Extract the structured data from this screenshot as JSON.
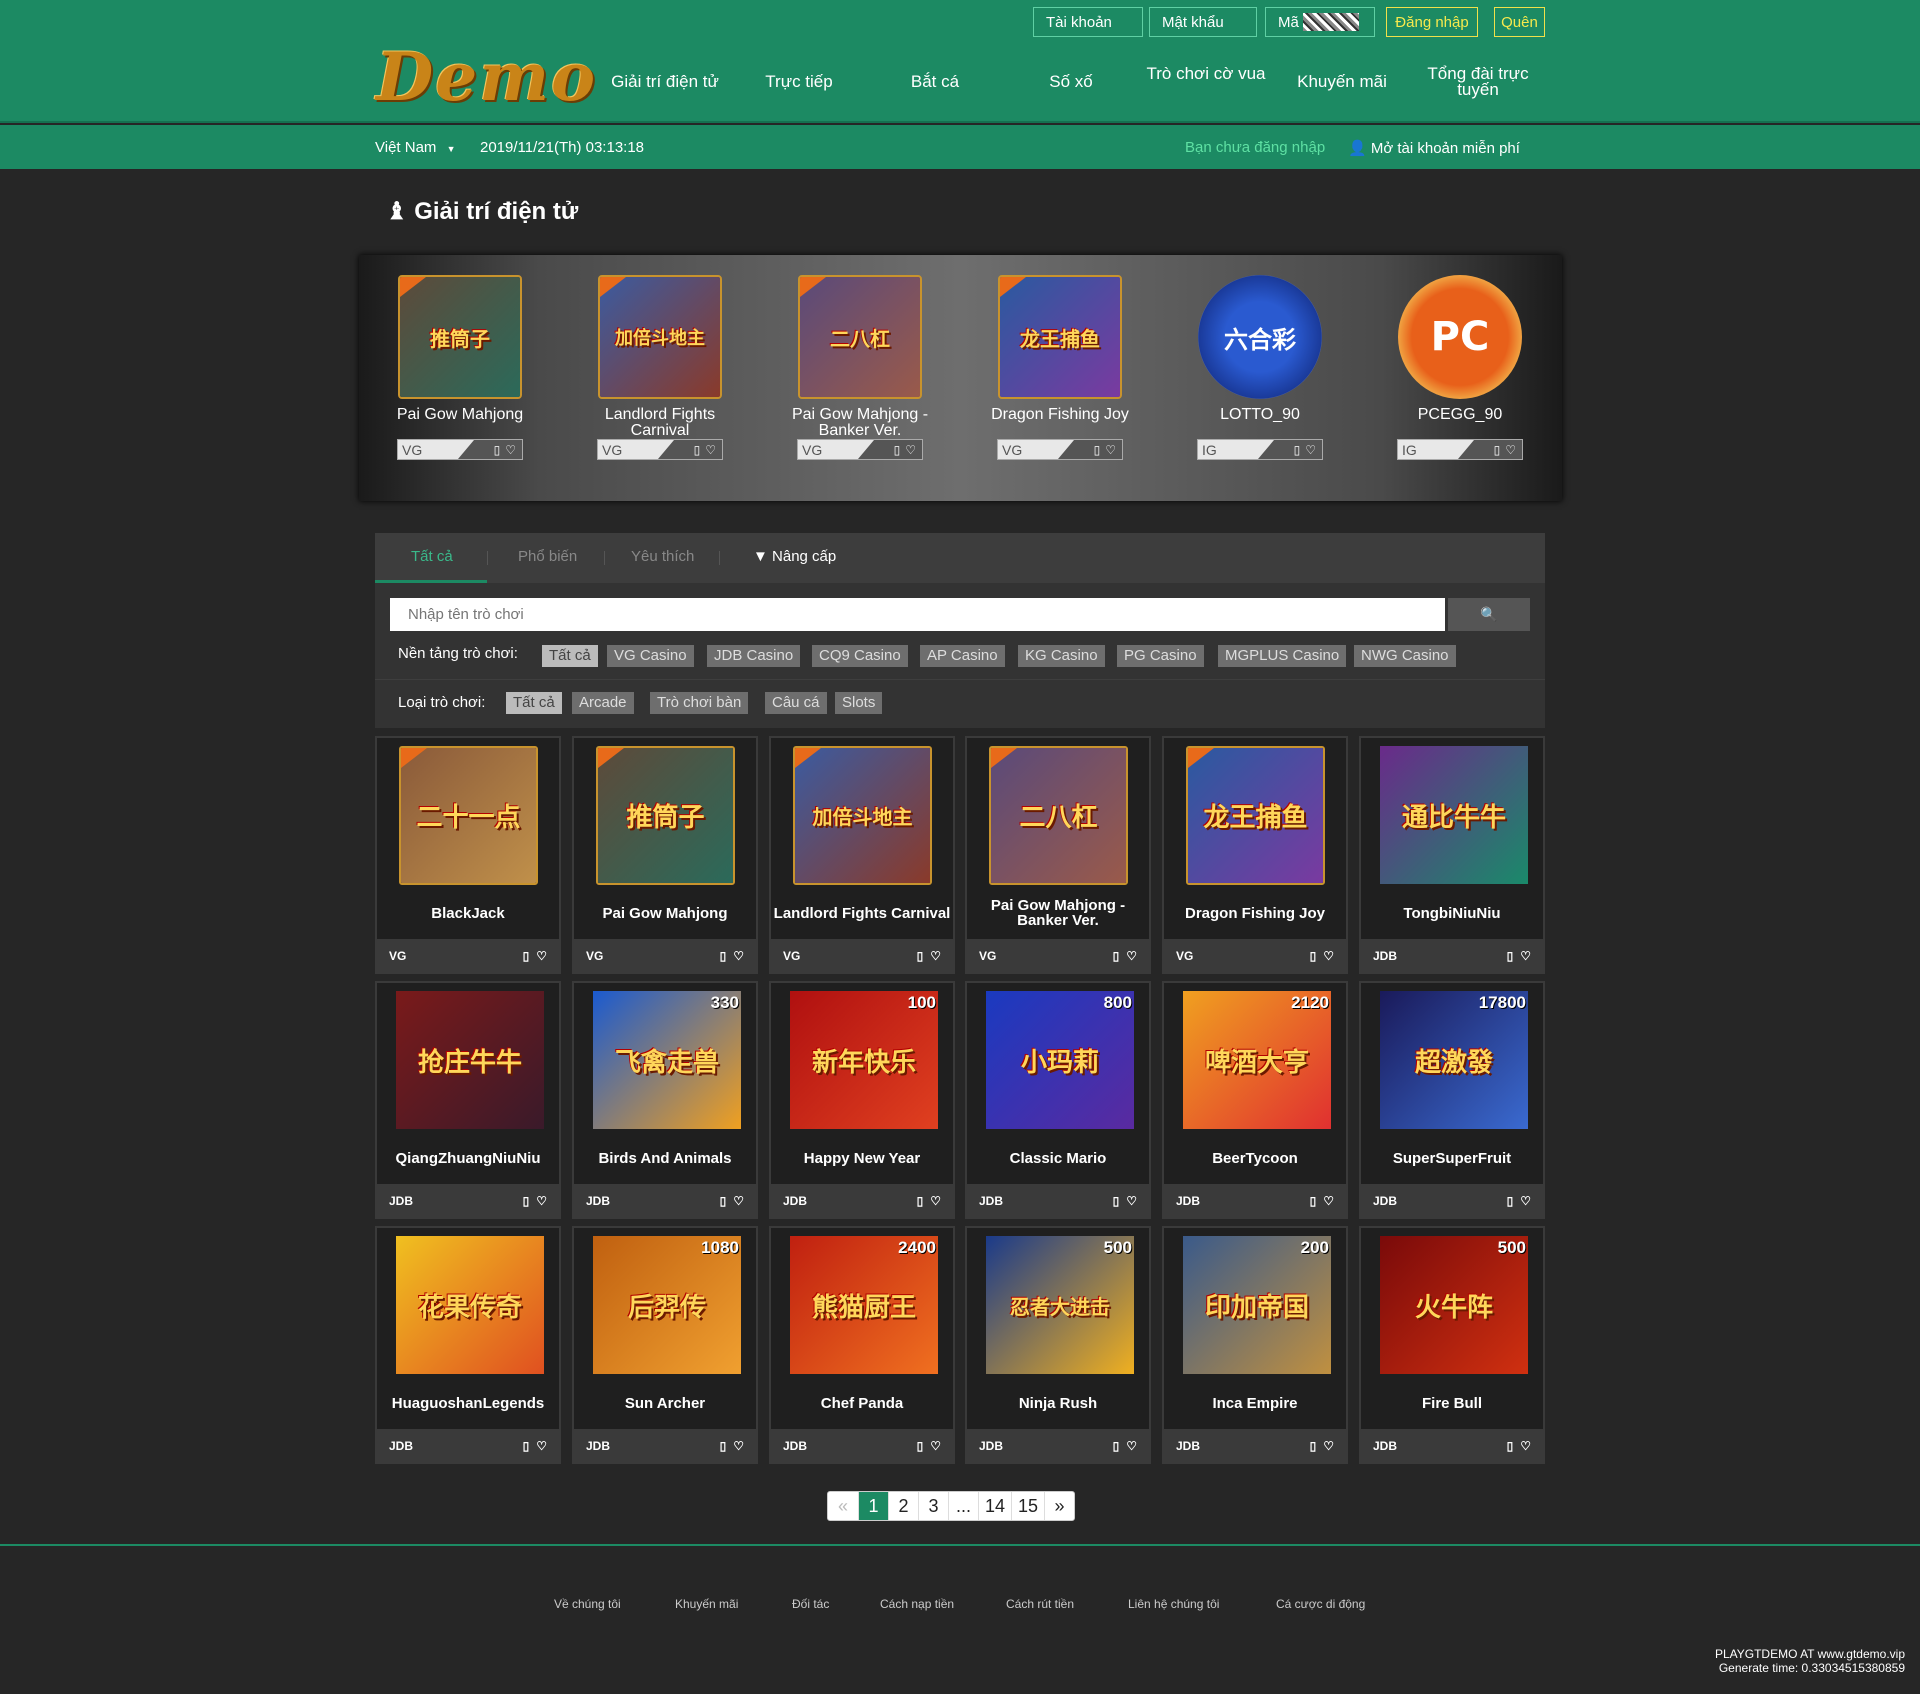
{
  "header": {
    "logo": "Demo",
    "account_placeholder": "Tài khoản",
    "password_placeholder": "Mật khẩu",
    "code_placeholder": "Mã",
    "login_label": "Đăng nhập",
    "forgot_label": "Quên",
    "nav": [
      "Giải trí điện tử",
      "Trực tiếp",
      "Bắt cá",
      "Số xố",
      "Trò chơi cờ vua",
      "Khuyến mãi",
      "Tổng đài trực tuyến"
    ]
  },
  "subbar": {
    "country": "Việt Nam",
    "datetime": "2019/11/21(Th) 03:13:18",
    "not_logged_in": "Bạn chưa đăng nhập",
    "open_account": "Mở tài khoản miễn phí"
  },
  "page_title": "Giải trí điện tử",
  "featured": [
    {
      "name": "Pai Gow Mahjong",
      "platform": "VG",
      "art": "推筒子",
      "colors": [
        "#5d4a3a",
        "#2b6a5a"
      ]
    },
    {
      "name": "Landlord Fights Carnival",
      "platform": "VG",
      "art": "加倍斗地主",
      "colors": [
        "#3b5ba0",
        "#8a3a2a"
      ]
    },
    {
      "name": "Pai Gow Mahjong - Banker Ver.",
      "platform": "VG",
      "art": "二八杠",
      "colors": [
        "#5a4a7a",
        "#9a5a4a"
      ]
    },
    {
      "name": "Dragon Fishing Joy",
      "platform": "VG",
      "art": "龙王捕鱼",
      "colors": [
        "#2a5aa0",
        "#7a3aa0"
      ]
    },
    {
      "name": "LOTTO_90",
      "platform": "IG",
      "art": "六合彩",
      "colors": [
        "#1a3a9a",
        "#2a5ad0"
      ]
    },
    {
      "name": "PCEGG_90",
      "platform": "IG",
      "art": "PC",
      "colors": [
        "#e8601a",
        "#f08a30"
      ]
    }
  ],
  "filter": {
    "tabs": [
      "Tất cả",
      "Phổ biến",
      "Yêu thích",
      "Nâng cấp"
    ],
    "search_placeholder": "Nhập tên trò chơi",
    "platform_label": "Nền tảng trò chơi:",
    "platforms": [
      "Tất cả",
      "VG Casino",
      "JDB Casino",
      "CQ9 Casino",
      "AP Casino",
      "KG Casino",
      "PG Casino",
      "MGPLUS Casino",
      "NWG Casino"
    ],
    "type_label": "Loại trò chơi:",
    "types": [
      "Tất cả",
      "Arcade",
      "Trò chơi bàn",
      "Câu cá",
      "Slots"
    ]
  },
  "games": [
    {
      "name": "BlackJack",
      "platform": "VG",
      "art": "二十一点",
      "score": "",
      "colors": [
        "#8a5a3a",
        "#c0904a"
      ]
    },
    {
      "name": "Pai Gow Mahjong",
      "platform": "VG",
      "art": "推筒子",
      "score": "",
      "colors": [
        "#5d4a3a",
        "#2b6a5a"
      ]
    },
    {
      "name": "Landlord Fights Carnival",
      "platform": "VG",
      "art": "加倍斗地主",
      "score": "",
      "colors": [
        "#3b5ba0",
        "#8a3a2a"
      ]
    },
    {
      "name": "Pai Gow Mahjong - Banker Ver.",
      "platform": "VG",
      "art": "二八杠",
      "score": "",
      "colors": [
        "#5a4a7a",
        "#9a5a4a"
      ]
    },
    {
      "name": "Dragon Fishing Joy",
      "platform": "VG",
      "art": "龙王捕鱼",
      "score": "",
      "colors": [
        "#2a5aa0",
        "#7a3aa0"
      ]
    },
    {
      "name": "TongbiNiuNiu",
      "platform": "JDB",
      "art": "通比牛牛",
      "score": "",
      "colors": [
        "#6a2a8a",
        "#1a8a6a"
      ]
    },
    {
      "name": "QiangZhuangNiuNiu",
      "platform": "JDB",
      "art": "抢庄牛牛",
      "score": "",
      "colors": [
        "#7a1a1a",
        "#3a1a2a"
      ]
    },
    {
      "name": "Birds And Animals",
      "platform": "JDB",
      "art": "飞禽走兽",
      "score": "330",
      "colors": [
        "#1a5ad0",
        "#f0a020"
      ]
    },
    {
      "name": "Happy New Year",
      "platform": "JDB",
      "art": "新年快乐",
      "score": "100",
      "colors": [
        "#b01010",
        "#e04020"
      ]
    },
    {
      "name": "Classic Mario",
      "platform": "JDB",
      "art": "小玛莉",
      "score": "800",
      "colors": [
        "#1a3ac0",
        "#5a2aa0"
      ]
    },
    {
      "name": "BeerTycoon",
      "platform": "JDB",
      "art": "啤酒大亨",
      "score": "2120",
      "colors": [
        "#f0a020",
        "#e03030"
      ]
    },
    {
      "name": "SuperSuperFruit",
      "platform": "JDB",
      "art": "超激發",
      "score": "17800",
      "colors": [
        "#1a1a5a",
        "#3a6ad0"
      ]
    },
    {
      "name": "HuaguoshanLegends",
      "platform": "JDB",
      "art": "花果传奇",
      "score": "",
      "colors": [
        "#f0c020",
        "#e05020"
      ]
    },
    {
      "name": "Sun Archer",
      "platform": "JDB",
      "art": "后羿传",
      "score": "1080",
      "colors": [
        "#c06010",
        "#f0a030"
      ]
    },
    {
      "name": "Chef Panda",
      "platform": "JDB",
      "art": "熊猫厨王",
      "score": "2400",
      "colors": [
        "#c02010",
        "#f07020"
      ]
    },
    {
      "name": "Ninja Rush",
      "platform": "JDB",
      "art": "忍者大进击",
      "score": "500",
      "colors": [
        "#1a3a8a",
        "#f0b020"
      ]
    },
    {
      "name": "Inca Empire",
      "platform": "JDB",
      "art": "印加帝国",
      "score": "200",
      "colors": [
        "#3a5a8a",
        "#c09040"
      ]
    },
    {
      "name": "Fire Bull",
      "platform": "JDB",
      "art": "火牛阵",
      "score": "500",
      "colors": [
        "#7a0a0a",
        "#d03010"
      ]
    }
  ],
  "pagination": [
    "«",
    "1",
    "2",
    "3",
    "...",
    "14",
    "15",
    "»"
  ],
  "footer": {
    "links": [
      "Về chúng tôi",
      "Khuyến mãi",
      "Đối tác",
      "Cách nạp tiền",
      "Cách rút tiền",
      "Liên hệ chúng tôi",
      "Cá cược di động"
    ],
    "site": "PLAYGTDEMO AT www.gtdemo.vip",
    "generate": "Generate time: 0.33034515380859"
  }
}
